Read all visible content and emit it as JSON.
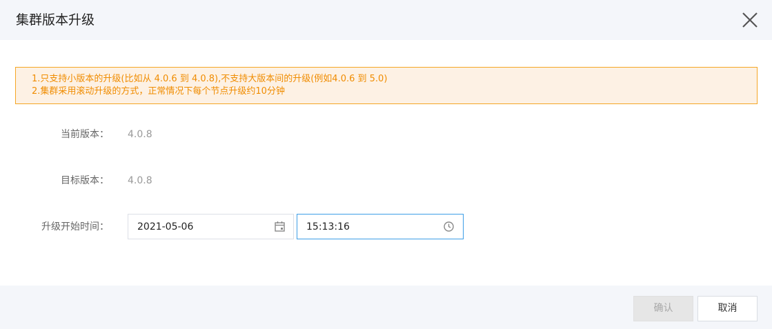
{
  "dialog": {
    "title": "集群版本升级",
    "notice": {
      "line1": "1.只支持小版本的升级(比如从 4.0.6 到 4.0.8),不支持大版本间的升级(例如4.0.6 到 5.0)",
      "line2": "2.集群采用滚动升级的方式，正常情况下每个节点升级约10分钟"
    },
    "form": {
      "current_version_label": "当前版本：",
      "current_version_value": "4.0.8",
      "target_version_label": "目标版本：",
      "target_version_value": "4.0.8",
      "start_time_label": "升级开始时间：",
      "date_value": "2021-05-06",
      "time_value": "15:13:16"
    },
    "buttons": {
      "confirm": "确认",
      "cancel": "取消"
    }
  },
  "icons": {
    "close": "close-icon",
    "calendar": "calendar-icon",
    "clock": "clock-icon"
  },
  "colors": {
    "notice_text": "#f08c00",
    "notice_border": "#f5a623",
    "notice_bg": "#fdf1e4",
    "focus_border": "#3c9de6",
    "header_bg": "#f4f6fa"
  }
}
